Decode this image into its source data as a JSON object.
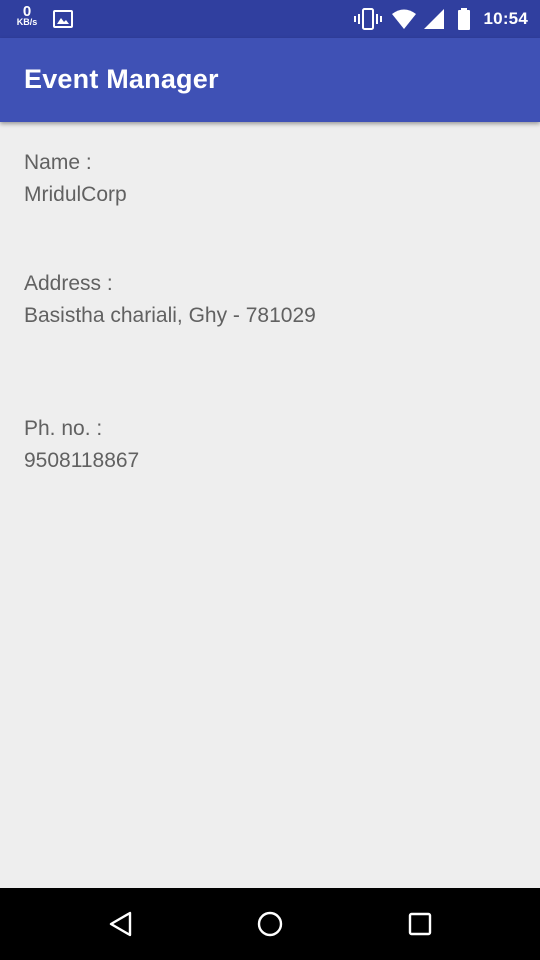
{
  "status_bar": {
    "net_speed_value": "0",
    "net_speed_unit": "KB/s",
    "time": "10:54",
    "icons": [
      "image-notification-icon",
      "vibrate-icon",
      "wifi-icon",
      "cellular-signal-icon",
      "battery-icon"
    ]
  },
  "app_bar": {
    "title": "Event Manager"
  },
  "details": {
    "name_label": "Name :",
    "name_value": "MridulCorp",
    "address_label": "Address :",
    "address_value": "Basistha chariali, Ghy - 781029",
    "phone_label": "Ph. no. :",
    "phone_value": "9508118867"
  },
  "nav_bar": {
    "buttons": [
      "back-icon",
      "home-icon",
      "recents-icon"
    ]
  },
  "colors": {
    "status_bar": "#303f9f",
    "app_bar": "#3f51b5",
    "background": "#eeeeee",
    "text": "#616161"
  }
}
